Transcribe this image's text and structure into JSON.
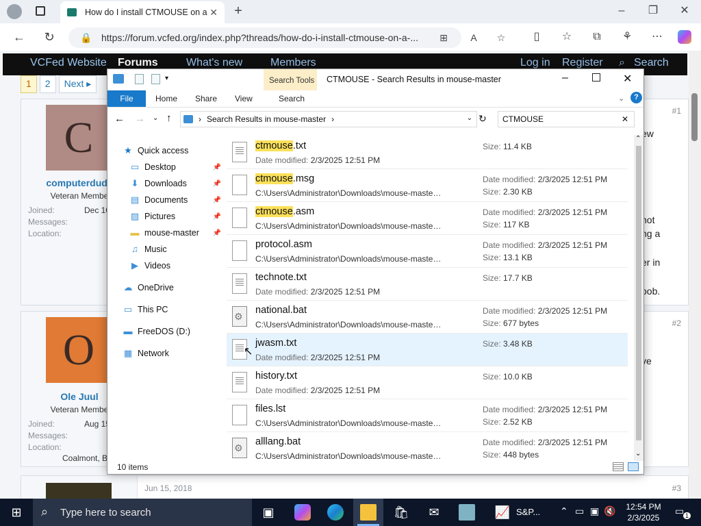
{
  "browser": {
    "tab_title": "How do I install CTMOUSE on a c",
    "url": "https://forum.vcfed.org/index.php?threads/how-do-i-install-ctmouse-on-a-...",
    "new_tab": "+"
  },
  "forum": {
    "nav": [
      "VCFed Website",
      "Forums",
      "What's new",
      "Members",
      "Log in",
      "Register",
      "Search"
    ],
    "pager": [
      "1",
      "2",
      "Next ▸"
    ],
    "posts": [
      {
        "initial": "C",
        "avatar_color": "#b08a84",
        "name": "computerdude",
        "title": "Veteran Membe",
        "joined_label": "Joined:",
        "joined": "Dec 10",
        "messages_label": "Messages:",
        "location_label": "Location:",
        "num": "#1",
        "text": [
          "ew",
          "not",
          "ng a",
          "er in",
          "oob."
        ]
      },
      {
        "initial": "O",
        "avatar_color": "#e07a35",
        "name": "Ole Juul",
        "title": "Veteran Membe",
        "joined_label": "Joined:",
        "joined": "Aug 15",
        "messages_label": "Messages:",
        "location_label": "Location:",
        "location": "Coalmont, BC, C",
        "num": "#2",
        "text": [
          "ve",
          "t"
        ]
      },
      {
        "date": "Jun 15, 2018",
        "num": "#3"
      }
    ]
  },
  "explorer": {
    "title": "CTMOUSE - Search Results in mouse-master",
    "search_tools": "Search Tools",
    "tabs": [
      "File",
      "Home",
      "Share",
      "View",
      "Search"
    ],
    "breadcrumb": "Search Results in mouse-master",
    "search_query": "CTMOUSE",
    "nav_items": [
      {
        "label": "Quick access",
        "icon": "★",
        "pinned": false
      },
      {
        "label": "Desktop",
        "icon": "▭",
        "pinned": true
      },
      {
        "label": "Downloads",
        "icon": "⬇",
        "pinned": true
      },
      {
        "label": "Documents",
        "icon": "▤",
        "pinned": true
      },
      {
        "label": "Pictures",
        "icon": "▨",
        "pinned": true
      },
      {
        "label": "mouse-master",
        "icon": "▬",
        "pinned": true
      },
      {
        "label": "Music",
        "icon": "♫",
        "pinned": false
      },
      {
        "label": "Videos",
        "icon": "▶",
        "pinned": false
      },
      {
        "label": "OneDrive",
        "icon": "☁",
        "pinned": false
      },
      {
        "label": "This PC",
        "icon": "▭",
        "pinned": false
      },
      {
        "label": "FreeDOS (D:)",
        "icon": "▬",
        "pinned": false
      },
      {
        "label": "Network",
        "icon": "▦",
        "pinned": false
      }
    ],
    "files": [
      {
        "hl": "ctmouse",
        "rest": ".txt",
        "icon": "txt",
        "sub_label": "Date modified:",
        "sub": "2/3/2025 12:51 PM",
        "r1_label": "Size:",
        "r1": "11.4 KB",
        "r2_label": "",
        "r2": ""
      },
      {
        "hl": "ctmouse",
        "rest": ".msg",
        "icon": "blank",
        "sub_label": "",
        "sub": "C:\\Users\\Administrator\\Downloads\\mouse-master\\mous...",
        "r1_label": "Date modified:",
        "r1": "2/3/2025 12:51 PM",
        "r2_label": "Size:",
        "r2": "2.30 KB"
      },
      {
        "hl": "ctmouse",
        "rest": ".asm",
        "icon": "blank",
        "sub_label": "",
        "sub": "C:\\Users\\Administrator\\Downloads\\mouse-master\\mous...",
        "r1_label": "Date modified:",
        "r1": "2/3/2025 12:51 PM",
        "r2_label": "Size:",
        "r2": "117 KB"
      },
      {
        "hl": "",
        "rest": "protocol.asm",
        "icon": "blank",
        "sub_label": "",
        "sub": "C:\\Users\\Administrator\\Downloads\\mouse-master\\mous...",
        "r1_label": "Date modified:",
        "r1": "2/3/2025 12:51 PM",
        "r2_label": "Size:",
        "r2": "13.1 KB"
      },
      {
        "hl": "",
        "rest": "technote.txt",
        "icon": "txt",
        "sub_label": "Date modified:",
        "sub": "2/3/2025 12:51 PM",
        "r1_label": "Size:",
        "r1": "17.7 KB",
        "r2_label": "",
        "r2": ""
      },
      {
        "hl": "",
        "rest": "national.bat",
        "icon": "bat",
        "sub_label": "",
        "sub": "C:\\Users\\Administrator\\Downloads\\mouse-master\\mous...",
        "r1_label": "Date modified:",
        "r1": "2/3/2025 12:51 PM",
        "r2_label": "Size:",
        "r2": "677 bytes"
      },
      {
        "hl": "",
        "rest": "jwasm.txt",
        "icon": "txt",
        "sub_label": "Date modified:",
        "sub": "2/3/2025 12:51 PM",
        "r1_label": "Size:",
        "r1": "3.48 KB",
        "r2_label": "",
        "r2": "",
        "hover": true
      },
      {
        "hl": "",
        "rest": "history.txt",
        "icon": "txt",
        "sub_label": "Date modified:",
        "sub": "2/3/2025 12:51 PM",
        "r1_label": "Size:",
        "r1": "10.0 KB",
        "r2_label": "",
        "r2": ""
      },
      {
        "hl": "",
        "rest": "files.lst",
        "icon": "blank",
        "sub_label": "",
        "sub": "C:\\Users\\Administrator\\Downloads\\mouse-master\\mous...",
        "r1_label": "Date modified:",
        "r1": "2/3/2025 12:51 PM",
        "r2_label": "Size:",
        "r2": "2.52 KB"
      },
      {
        "hl": "",
        "rest": "alllang.bat",
        "icon": "bat",
        "sub_label": "",
        "sub": "C:\\Users\\Administrator\\Downloads\\mouse-master\\mous...",
        "r1_label": "Date modified:",
        "r1": "2/3/2025 12:51 PM",
        "r2_label": "Size:",
        "r2": "448 bytes"
      }
    ],
    "status": "10 items"
  },
  "taskbar": {
    "search_placeholder": "Type here to search",
    "sp_label": "S&P...",
    "time": "12:54 PM",
    "date": "2/3/2025",
    "notif_count": "1"
  },
  "colors": {
    "accent": "#1979ca",
    "highlight": "#fbe05a",
    "selection": "#cce8ff",
    "hover": "#e5f3ff"
  }
}
